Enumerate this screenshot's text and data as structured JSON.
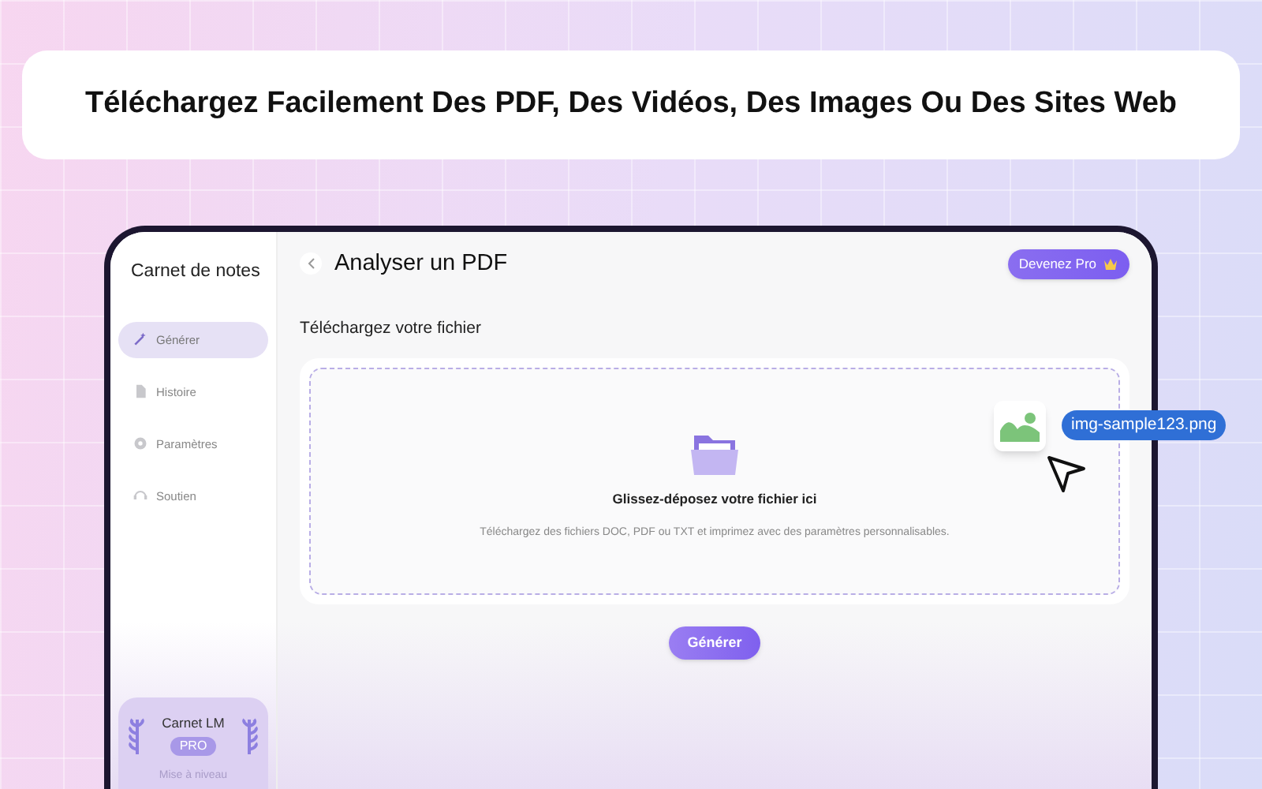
{
  "headline": "Téléchargez Facilement Des PDF, Des Vidéos, Des Images Ou Des Sites Web",
  "sidebar": {
    "title": "Carnet de notes",
    "items": [
      {
        "label": "Générer",
        "kind": "wand",
        "selected": true
      },
      {
        "label": "Histoire",
        "kind": "document",
        "selected": false
      },
      {
        "label": "Paramètres",
        "kind": "gear",
        "selected": false
      },
      {
        "label": "Soutien",
        "kind": "headset",
        "selected": false
      }
    ],
    "pro_card": {
      "name": "Carnet LM",
      "badge": "PRO",
      "action": "Mise à niveau"
    }
  },
  "header": {
    "title": "Analyser un PDF",
    "upgrade_button": "Devenez Pro"
  },
  "upload": {
    "heading": "Téléchargez votre fichier",
    "dropzone_title": "Glissez-déposez votre fichier ici",
    "dropzone_hint": "Téléchargez des fichiers DOC, PDF ou TXT et imprimez avec des paramètres personnalisables.",
    "button": "Générer"
  },
  "dragged_file": {
    "name": "img-sample123.png"
  }
}
